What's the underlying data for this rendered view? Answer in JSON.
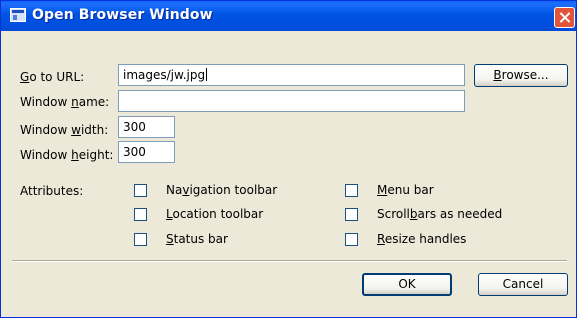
{
  "window": {
    "title": "Open Browser Window",
    "title_icon": "browser-window-icon",
    "close_icon": "close-icon"
  },
  "colors": {
    "titlebar": "#0054e3",
    "close_button": "#e2553b",
    "dialog_bg": "#ece9d8",
    "field_border": "#7f9db9"
  },
  "form": {
    "url": {
      "label_key": "G",
      "label_rest": "o to URL:",
      "value": "images/jw.jpg"
    },
    "name": {
      "label_pre": "Window ",
      "label_key": "n",
      "label_post": "ame:",
      "value": ""
    },
    "width": {
      "label_pre": "Window ",
      "label_key": "w",
      "label_post": "idth:",
      "value": "300"
    },
    "height": {
      "label_pre": "Window ",
      "label_key": "h",
      "label_post": "eight:",
      "value": "300"
    },
    "browse": {
      "label_key": "B",
      "label_rest": "rowse..."
    }
  },
  "attributes": {
    "label": "Attributes:",
    "items": [
      {
        "pre": "Na",
        "key": "v",
        "post": "igation toolbar",
        "checked": false
      },
      {
        "pre": "",
        "key": "L",
        "post": "ocation toolbar",
        "checked": false
      },
      {
        "pre": "",
        "key": "S",
        "post": "tatus bar",
        "checked": false
      },
      {
        "pre": "",
        "key": "M",
        "post": "enu bar",
        "checked": false
      },
      {
        "pre": "Scroll",
        "key": "b",
        "post": "ars as needed",
        "checked": false
      },
      {
        "pre": "",
        "key": "R",
        "post": "esize handles",
        "checked": false
      }
    ]
  },
  "buttons": {
    "ok": "OK",
    "cancel": "Cancel"
  }
}
